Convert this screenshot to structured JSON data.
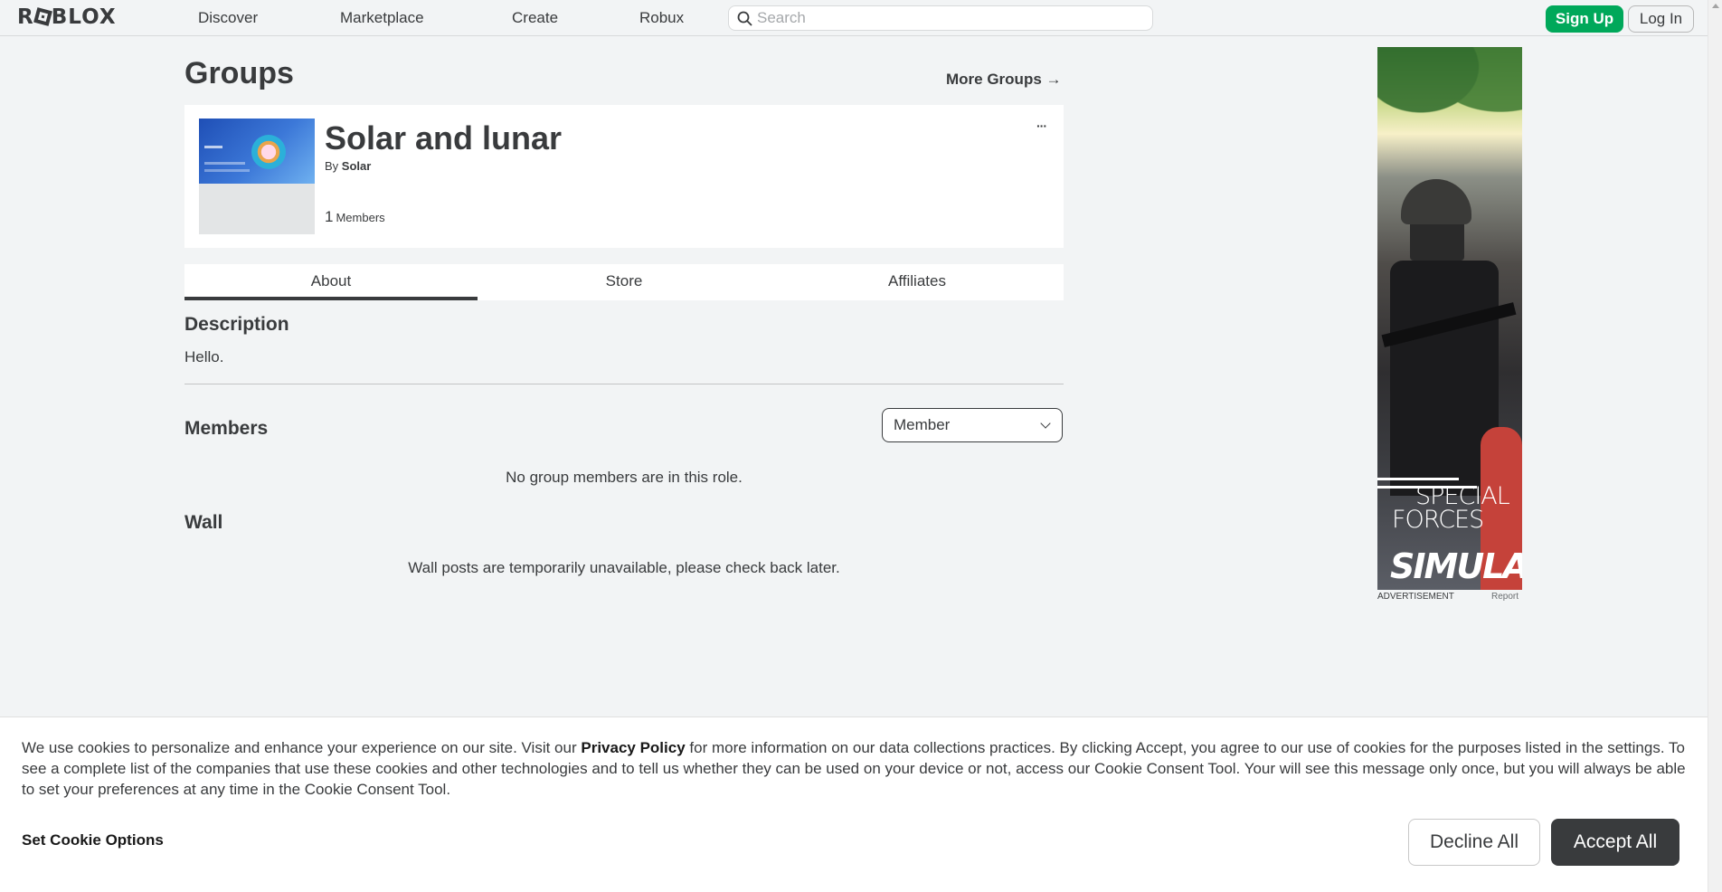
{
  "header": {
    "logo": "ROBLOX",
    "logo_parts": {
      "before": "R",
      "after": "BLOX"
    },
    "nav": [
      "Discover",
      "Marketplace",
      "Create",
      "Robux"
    ],
    "search": {
      "placeholder": "Search",
      "value": ""
    },
    "signup_label": "Sign Up",
    "login_label": "Log In"
  },
  "main": {
    "title": "Groups",
    "more_groups": "More Groups →",
    "group": {
      "name": "Solar and lunar",
      "by_prefix": "By",
      "owner": "Solar",
      "member_count": "1",
      "member_label": "Members"
    },
    "tabs": [
      "About",
      "Store",
      "Affiliates"
    ],
    "active_tab": "About",
    "description": {
      "heading": "Description",
      "text": "Hello."
    },
    "members": {
      "heading": "Members",
      "role_selected": "Member",
      "empty": "No group members are in this role."
    },
    "wall": {
      "heading": "Wall",
      "message": "Wall posts are temporarily unavailable, please check back later."
    }
  },
  "ad": {
    "title_line1": "SPECIAL",
    "title_line2": "FORCES",
    "title_line3": "SIMULATOR",
    "label": "ADVERTISEMENT",
    "report": "Report"
  },
  "cookie": {
    "text_before": "We use cookies to personalize and enhance your experience on our site. Visit our ",
    "link": "Privacy Policy",
    "text_after": " for more information on our data collections practices. By clicking Accept, you agree to our use of cookies for the purposes listed in the settings. To see a complete list of the companies that use these cookies and other technologies and to tell us whether they can be used on your device or not, access our Cookie Consent Tool. Your will see this message only once, but you will always be able to set your preferences at any time in the Cookie Consent Tool.",
    "options_label": "Set Cookie Options",
    "decline_label": "Decline All",
    "accept_label": "Accept All"
  },
  "colors": {
    "accent_green": "#00a85a",
    "text": "#393b3d",
    "background": "#f2f4f5"
  }
}
